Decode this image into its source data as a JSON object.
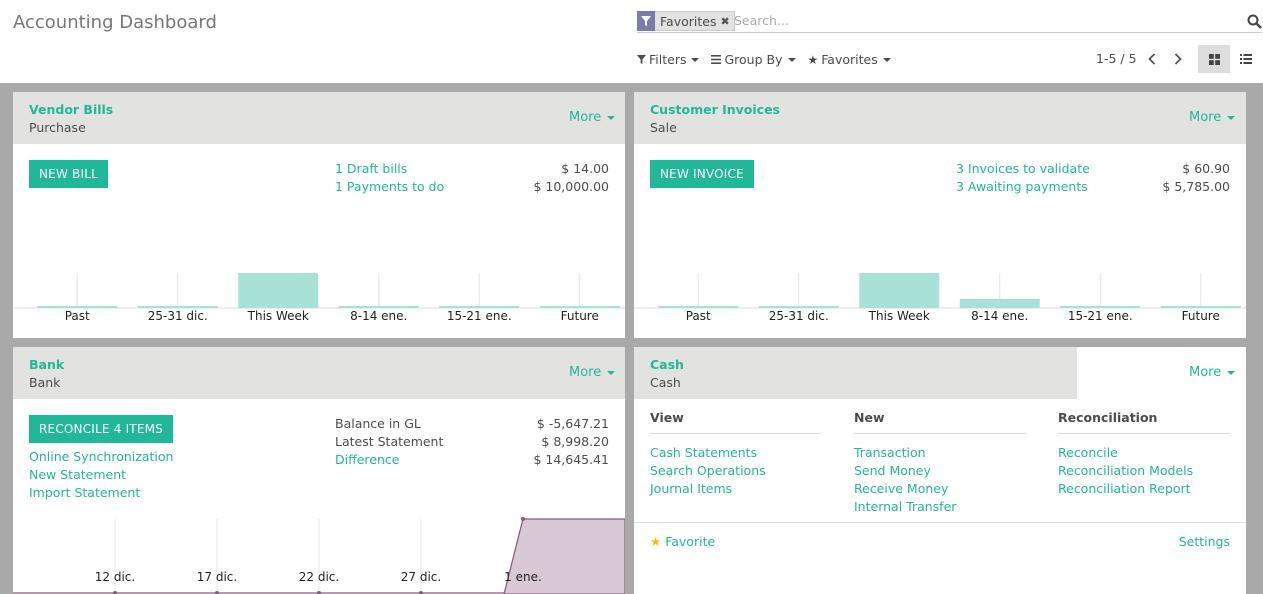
{
  "header": {
    "title": "Accounting Dashboard",
    "facet_label": "Favorites",
    "search_placeholder": "Search...",
    "options": {
      "filters": "Filters",
      "group_by": "Group By",
      "favorites": "Favorites"
    },
    "pager": "1-5 / 5"
  },
  "vendor_bills": {
    "title": "Vendor Bills",
    "subtitle": "Purchase",
    "more": "More",
    "button": "NEW BILL",
    "lines": [
      {
        "label": "1 Draft bills",
        "amount": "$ 14.00"
      },
      {
        "label": "1 Payments to do",
        "amount": "$ 10,000.00"
      }
    ],
    "chart_data": {
      "type": "bar",
      "categories": [
        "Past",
        "25-31 dic.",
        "This Week",
        "8-14 ene.",
        "15-21 ene.",
        "Future"
      ],
      "values": [
        0,
        0,
        10000,
        0,
        0,
        0
      ]
    }
  },
  "customer_invoices": {
    "title": "Customer Invoices",
    "subtitle": "Sale",
    "more": "More",
    "button": "NEW INVOICE",
    "lines": [
      {
        "label": "3 Invoices to validate",
        "amount": "$ 60.90"
      },
      {
        "label": "3 Awaiting payments",
        "amount": "$ 5,785.00"
      }
    ],
    "chart_data": {
      "type": "bar",
      "categories": [
        "Past",
        "25-31 dic.",
        "This Week",
        "8-14 ene.",
        "15-21 ene.",
        "Future"
      ],
      "values": [
        0,
        0,
        5785,
        1500,
        0,
        0
      ]
    }
  },
  "bank": {
    "title": "Bank",
    "subtitle": "Bank",
    "more": "More",
    "button": "RECONCILE 4 ITEMS",
    "links": [
      "Online Synchronization",
      "New Statement",
      "Import Statement"
    ],
    "balance_gl_label": "Balance in GL",
    "balance_gl_amount": "$ -5,647.21",
    "latest_statement_label": "Latest Statement",
    "latest_statement_amount": "$ 8,998.20",
    "difference_label": "Difference",
    "difference_amount": "$ 14,645.41",
    "chart_data": {
      "type": "area",
      "x": [
        "12 dic.",
        "17 dic.",
        "22 dic.",
        "27 dic.",
        "1 ene."
      ],
      "values": [
        0,
        0,
        0,
        0,
        8998.2
      ]
    }
  },
  "cash": {
    "title": "Cash",
    "subtitle": "Cash",
    "more": "More",
    "columns": [
      {
        "heading": "View",
        "items": [
          "Cash Statements",
          "Search Operations",
          "Journal Items"
        ]
      },
      {
        "heading": "New",
        "items": [
          "Transaction",
          "Send Money",
          "Receive Money",
          "Internal Transfer"
        ]
      },
      {
        "heading": "Reconciliation",
        "items": [
          "Reconcile",
          "Reconciliation Models",
          "Reconciliation Report"
        ]
      }
    ],
    "favorite": "Favorite",
    "settings": "Settings"
  },
  "colors": {
    "accent": "#21b799",
    "bar": "#a8e2d6",
    "area": "#d9c9d6",
    "area_line": "#875a7b",
    "facet": "#7c7bad"
  }
}
